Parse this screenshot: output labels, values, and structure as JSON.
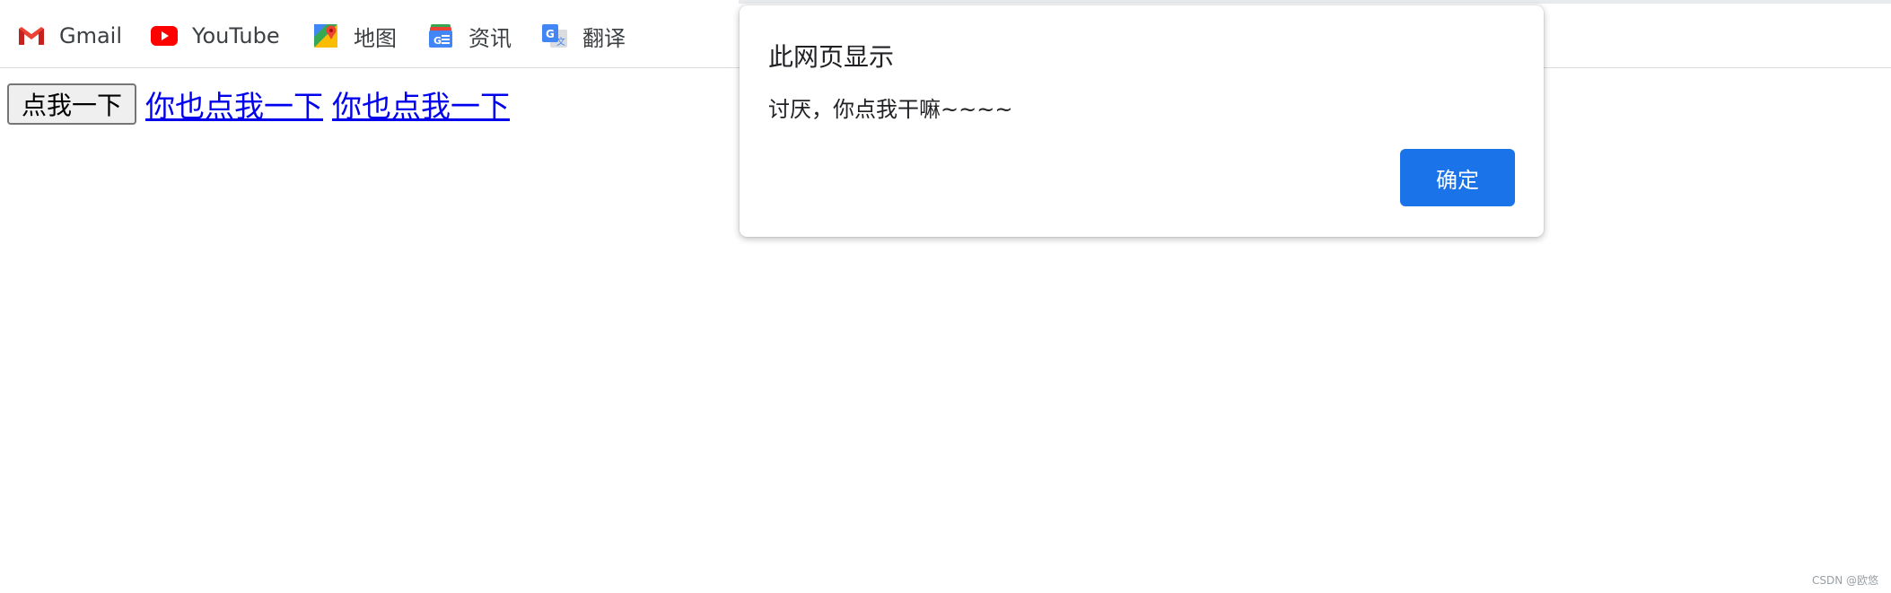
{
  "bookmarks": {
    "items": [
      {
        "label": "Gmail",
        "icon": "gmail-icon"
      },
      {
        "label": "YouTube",
        "icon": "youtube-icon"
      },
      {
        "label": "地图",
        "icon": "maps-icon"
      },
      {
        "label": "资讯",
        "icon": "news-icon"
      },
      {
        "label": "翻译",
        "icon": "translate-icon"
      }
    ]
  },
  "page": {
    "button_label": "点我一下",
    "link1_label": "你也点我一下",
    "link2_label": "你也点我一下"
  },
  "alert": {
    "title": "此网页显示",
    "message": "讨厌，你点我干嘛~~~~",
    "ok_label": "确定"
  },
  "watermark": "CSDN @欧悠",
  "colors": {
    "link": "#0000ee",
    "ok_button": "#1a73e8",
    "youtube": "#ff0000",
    "gmail": "#ea4335"
  }
}
